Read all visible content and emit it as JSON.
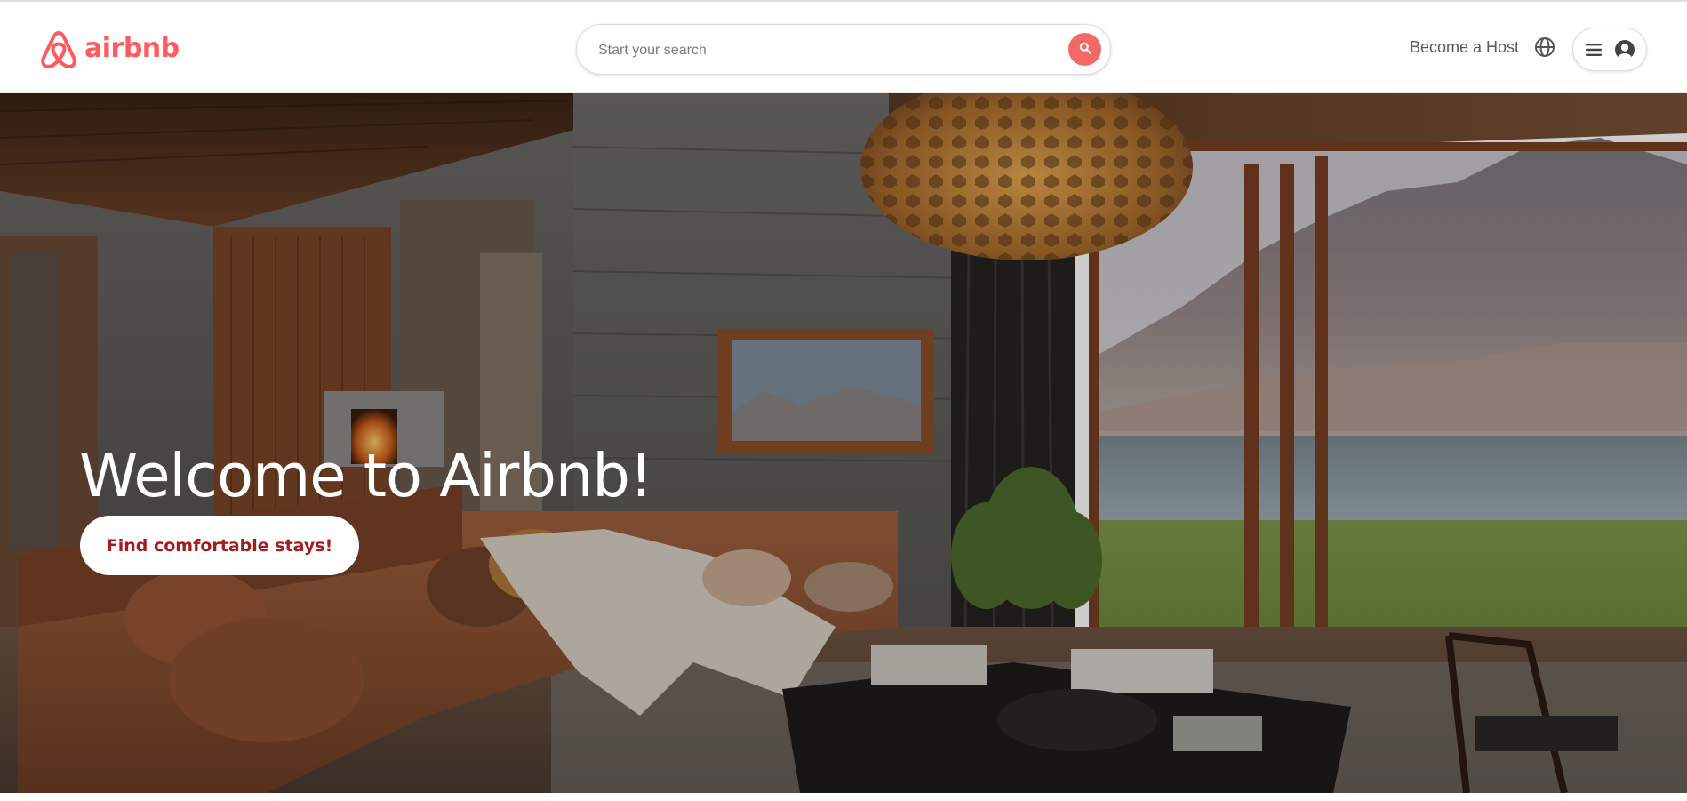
{
  "header": {
    "logo_text": "airbnb",
    "search": {
      "placeholder": "Start your search"
    },
    "host_link": "Become a Host",
    "icons": {
      "logo": "airbnb-belo-icon",
      "search": "search-icon",
      "globe": "globe-icon",
      "menu": "hamburger-menu-icon",
      "user": "user-avatar-icon"
    }
  },
  "hero": {
    "title": "Welcome to Airbnb!",
    "cta_label": "Find comfortable stays!"
  },
  "colors": {
    "brand": "#FF5A5F",
    "search_button": "#F46868",
    "cta_text": "#A51C20"
  }
}
